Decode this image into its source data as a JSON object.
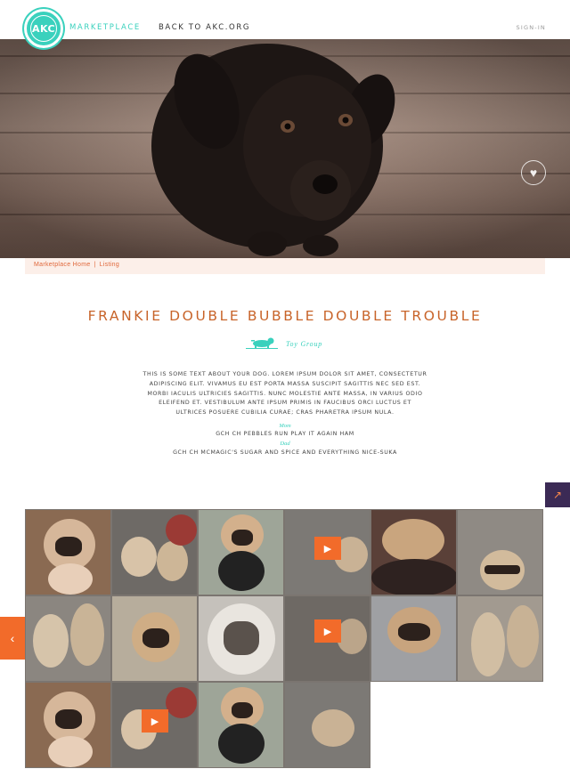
{
  "header": {
    "logo_text": "AKC",
    "marketplace_label": "MARKETPLACE",
    "back_link": "BACK TO AKC.ORG",
    "signin_label": "SIGN-IN"
  },
  "hero": {
    "favorite_icon": "heart-icon"
  },
  "breadcrumb": {
    "home": "Marketplace Home",
    "separator": "|",
    "current": "Listing"
  },
  "listing": {
    "title": "FRANKIE DOUBLE BUBBLE DOUBLE TROUBLE",
    "group_label": "Toy Group",
    "description": "THIS IS SOME TEXT ABOUT YOUR DOG. LOREM IPSUM DOLOR SIT AMET, CONSECTETUR ADIPISCING ELIT. VIVAMUS EU EST PORTA MASSA SUSCIPIT SAGITTIS NEC SED EST. MORBI IACULIS ULTRICIES SAGITTIS. NUNC MOLESTIE ANTE MASSA, IN VARIUS ODIO ELEIFEND ET. VESTIBULUM ANTE IPSUM PRIMIS IN FAUCIBUS ORCI LUCTUS ET ULTRICES POSUERE CUBILIA CURAE; CRAS PHARETRA IPSUM NULA.",
    "mom_label": "Mom",
    "mom_name": "GCH CH PEBBLES RUN PLAY IT AGAIN HAM",
    "dad_label": "Dad",
    "dad_name": "GCH CH MCMAGIC'S SUGAR AND SPICE AND EVERYTHING NICE-SUKA"
  },
  "controls": {
    "share_icon": "share-icon",
    "prev_icon": "chevron-left-icon",
    "play_icon": "play-icon"
  },
  "colors": {
    "accent_teal": "#3ad1bd",
    "title_orange": "#c8642a",
    "button_orange": "#f26b2a",
    "share_bg": "#3b2a55",
    "breadcrumb_bg": "#fcefe9"
  }
}
